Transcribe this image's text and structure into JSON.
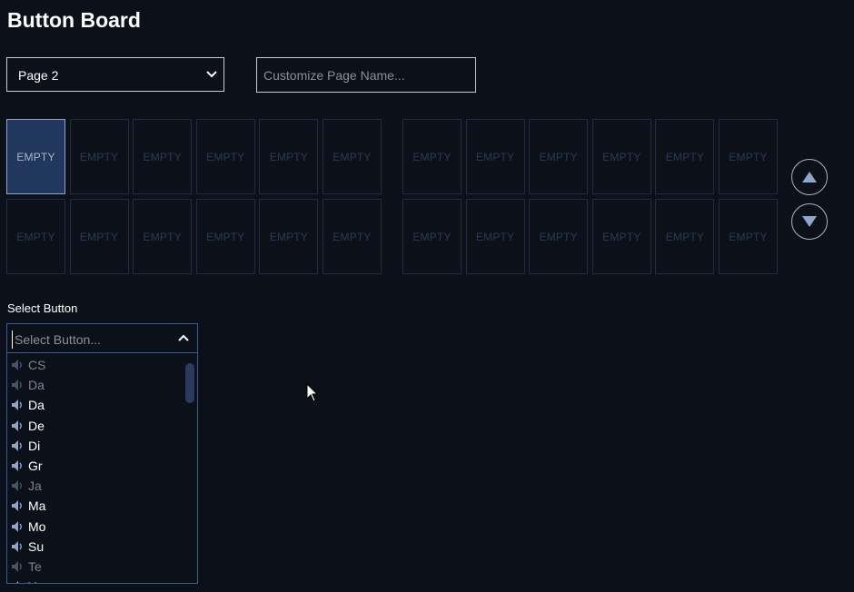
{
  "header": {
    "title": "Button Board"
  },
  "page_select": {
    "value": "Page 2"
  },
  "page_name": {
    "placeholder": "Customize Page Name...",
    "value": ""
  },
  "grid": {
    "slot_label": "EMPTY",
    "left": [
      "EMPTY",
      "EMPTY",
      "EMPTY",
      "EMPTY",
      "EMPTY",
      "EMPTY",
      "EMPTY",
      "EMPTY",
      "EMPTY",
      "EMPTY",
      "EMPTY",
      "EMPTY"
    ],
    "right": [
      "EMPTY",
      "EMPTY",
      "EMPTY",
      "EMPTY",
      "EMPTY",
      "EMPTY",
      "EMPTY",
      "EMPTY",
      "EMPTY",
      "EMPTY",
      "EMPTY",
      "EMPTY"
    ],
    "selected_slot": "left-1"
  },
  "nav": {
    "up_icon": "triangle-up-icon",
    "down_icon": "triangle-down-icon"
  },
  "select_button": {
    "label": "Select Button",
    "placeholder": "Select Button...",
    "items": [
      {
        "text": "CS",
        "dim": true
      },
      {
        "text": "Da",
        "dim": true
      },
      {
        "text": "Da",
        "dim": false
      },
      {
        "text": "De",
        "dim": false
      },
      {
        "text": "Di",
        "dim": false
      },
      {
        "text": "Gr",
        "dim": false
      },
      {
        "text": "Ja",
        "dim": true
      },
      {
        "text": "Ma",
        "dim": false
      },
      {
        "text": "Mo",
        "dim": false
      },
      {
        "text": "Su",
        "dim": false
      },
      {
        "text": "Te",
        "dim": true
      },
      {
        "text": "Yo",
        "dim": false
      }
    ]
  },
  "colors": {
    "background": "#0c1119",
    "accent": "#22375e",
    "border": "#1e2b42",
    "speaker_icon": "#8ea6cc"
  }
}
